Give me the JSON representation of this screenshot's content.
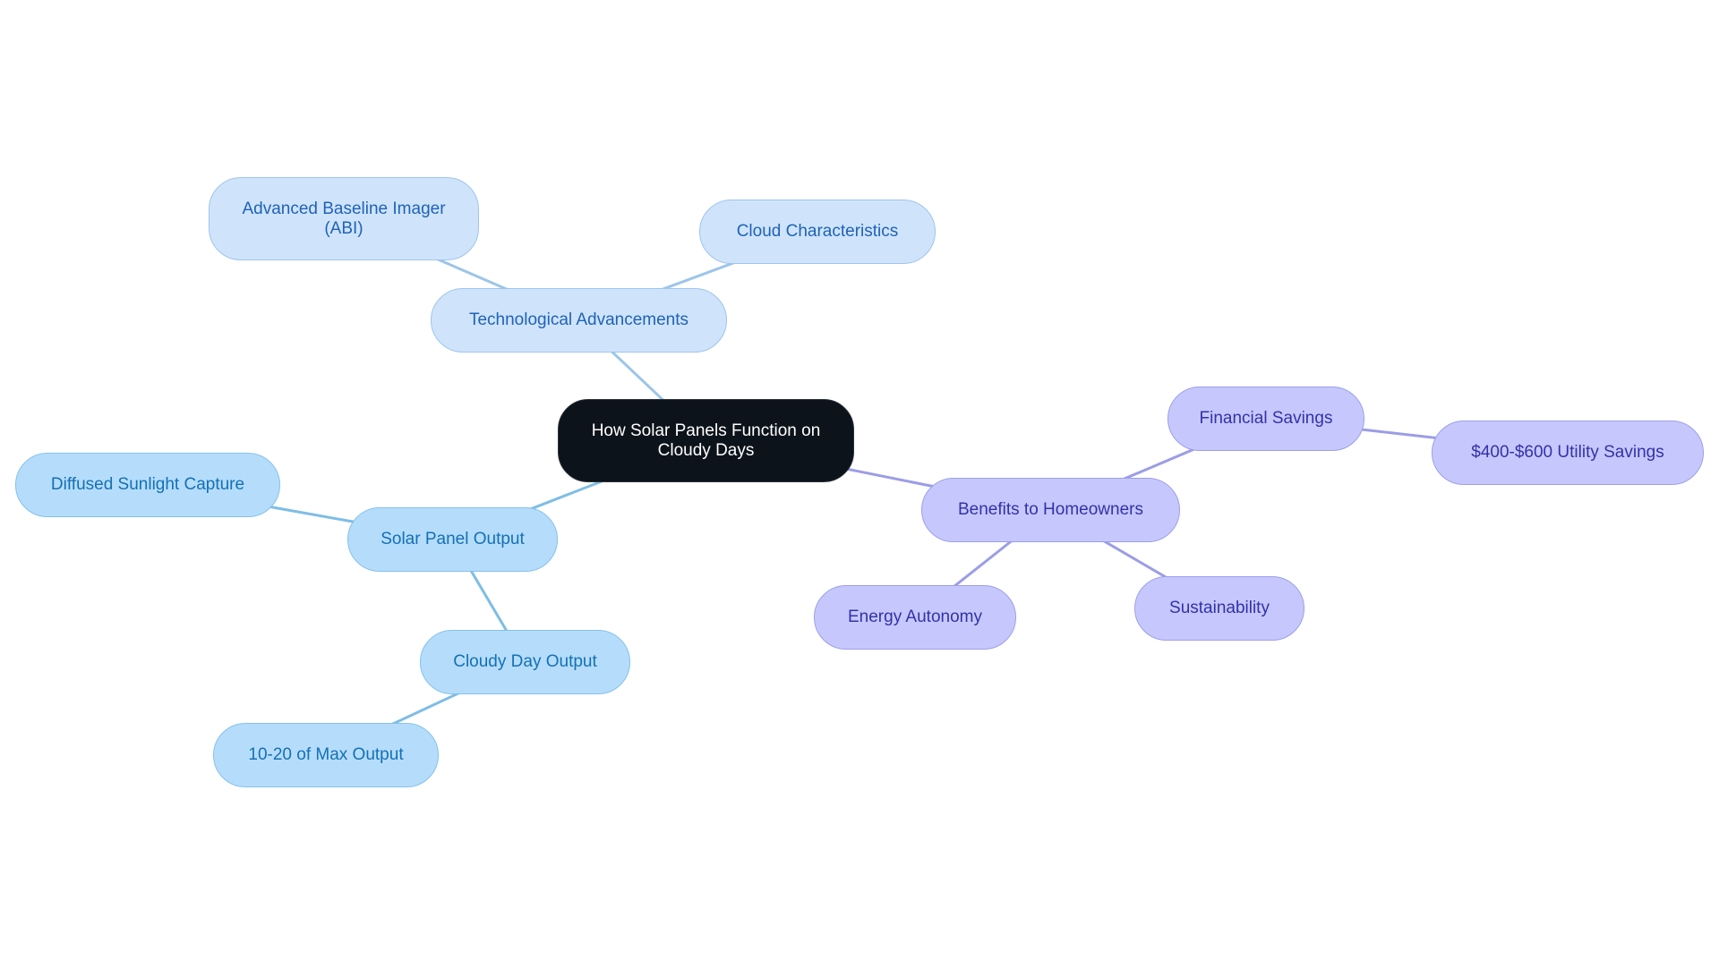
{
  "title": "How Solar Panels Function on Cloudy Days",
  "colors": {
    "root_fill": "#0d131a",
    "tech_fill": "#cfe4fb",
    "tech_edge": "#9cc5e8",
    "solar_fill": "#b5ddfb",
    "solar_edge": "#7dbde6",
    "benefit_fill": "#c6c8fd",
    "benefit_edge": "#9b9de6"
  },
  "nodes": {
    "root": "How Solar Panels Function on Cloudy Days",
    "tech": "Technological Advancements",
    "abi": "Advanced Baseline Imager (ABI)",
    "cloud_char": "Cloud Characteristics",
    "solar_output": "Solar Panel Output",
    "diffused": "Diffused Sunlight Capture",
    "cloudy_day": "Cloudy Day Output",
    "max_output": "10-20 of Max Output",
    "benefits": "Benefits to Homeowners",
    "financial": "Financial Savings",
    "utility": "$400-$600 Utility Savings",
    "autonomy": "Energy Autonomy",
    "sustainability": "Sustainability"
  },
  "edges": [
    {
      "from": "root",
      "to": "tech",
      "branch": "tech"
    },
    {
      "from": "tech",
      "to": "abi",
      "branch": "tech"
    },
    {
      "from": "tech",
      "to": "cloud_char",
      "branch": "tech"
    },
    {
      "from": "root",
      "to": "solar_output",
      "branch": "solar"
    },
    {
      "from": "solar_output",
      "to": "diffused",
      "branch": "solar"
    },
    {
      "from": "solar_output",
      "to": "cloudy_day",
      "branch": "solar"
    },
    {
      "from": "cloudy_day",
      "to": "max_output",
      "branch": "solar"
    },
    {
      "from": "root",
      "to": "benefits",
      "branch": "benefit"
    },
    {
      "from": "benefits",
      "to": "financial",
      "branch": "benefit"
    },
    {
      "from": "financial",
      "to": "utility",
      "branch": "benefit"
    },
    {
      "from": "benefits",
      "to": "autonomy",
      "branch": "benefit"
    },
    {
      "from": "benefits",
      "to": "sustainability",
      "branch": "benefit"
    }
  ]
}
